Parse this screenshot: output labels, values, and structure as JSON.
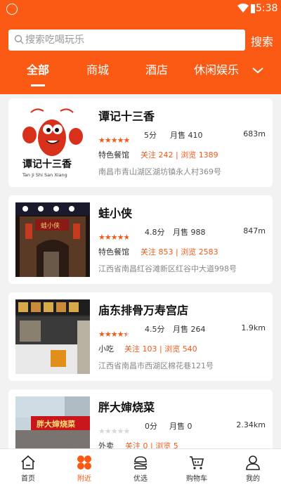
{
  "status_bar": {
    "time": "5:38"
  },
  "search": {
    "placeholder": "搜索吃喝玩乐",
    "button_label": "搜索"
  },
  "tabs": [
    {
      "label": "全部",
      "active": true
    },
    {
      "label": "商城",
      "active": false
    },
    {
      "label": "酒店",
      "active": false
    },
    {
      "label": "休闲娱乐",
      "active": false
    }
  ],
  "colors": {
    "brand": "#fa5a14",
    "star": "#f05a1a",
    "star_empty": "#d8d8d8"
  },
  "shops": [
    {
      "name": "谭记十三香",
      "rating": 5,
      "score": "5分",
      "sales": "月售 410",
      "distance": "683m",
      "category": "特色餐馆",
      "follow": "关注 242 | 浏览 1389",
      "address": "南昌市青山湖区湖坊镇永人村369号",
      "thumb_text": "谭记十三香",
      "thumb_sub": "Tan Ji Shi San Xiang"
    },
    {
      "name": "蛙小侠",
      "rating": 4.8,
      "score": "4.8分",
      "sales": "月售 988",
      "distance": "847m",
      "category": "特色餐馆",
      "follow": "关注 853 | 浏览 2583",
      "address": "江西省南昌红谷滩新区红谷中大道998号",
      "thumb_text": "蛙小侠"
    },
    {
      "name": "庙东排骨万寿宫店",
      "rating": 4.5,
      "score": "4.5分",
      "sales": "月售 264",
      "distance": "1.9km",
      "category": "小吃",
      "follow": "关注 103 | 浏览 540",
      "address": "江西省南昌市西湖区棉花巷121号"
    },
    {
      "name": "胖大婶烧菜",
      "rating": 0,
      "score": "0分",
      "sales": "月售 0",
      "distance": "2.34km",
      "category": "外卖",
      "follow": "关注 0 | 浏览 5",
      "address": "",
      "thumb_text": "胖大婶烧菜"
    }
  ],
  "bottom_nav": [
    {
      "label": "首页",
      "icon": "home-icon",
      "active": false
    },
    {
      "label": "附近",
      "icon": "nearby-icon",
      "active": true
    },
    {
      "label": "优选",
      "icon": "pick-icon",
      "active": false
    },
    {
      "label": "购物车",
      "icon": "cart-icon",
      "active": false
    },
    {
      "label": "我的",
      "icon": "user-icon",
      "active": false
    }
  ]
}
